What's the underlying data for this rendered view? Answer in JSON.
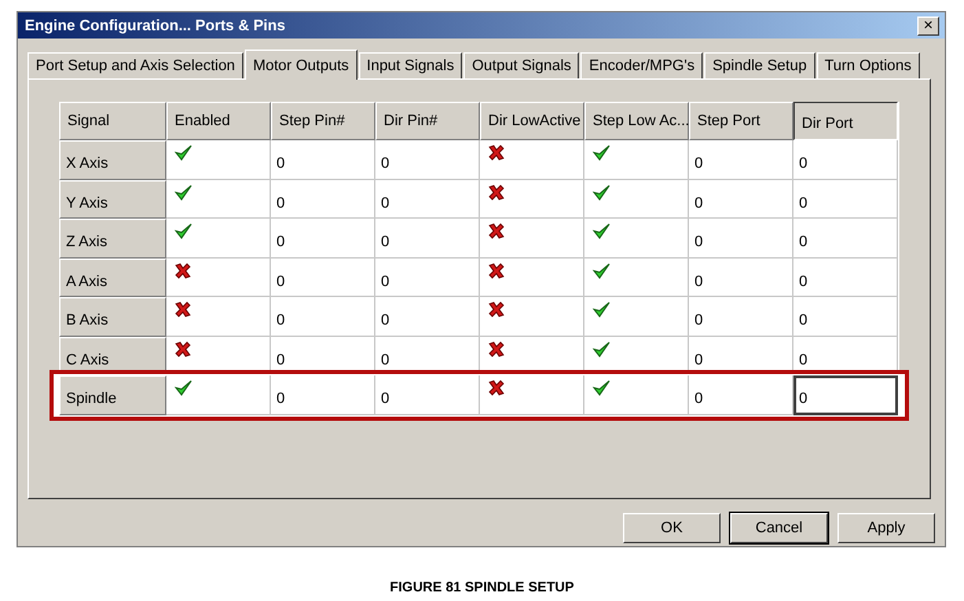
{
  "window": {
    "title": "Engine Configuration... Ports & Pins",
    "close": "×"
  },
  "tabs": [
    {
      "label": "Port Setup and Axis Selection",
      "selected": false
    },
    {
      "label": "Motor Outputs",
      "selected": true
    },
    {
      "label": "Input Signals",
      "selected": false
    },
    {
      "label": "Output Signals",
      "selected": false
    },
    {
      "label": "Encoder/MPG's",
      "selected": false
    },
    {
      "label": "Spindle Setup",
      "selected": false
    },
    {
      "label": "Turn Options",
      "selected": false
    }
  ],
  "table": {
    "columns": [
      {
        "label": "Signal",
        "kind": "text",
        "selected": false
      },
      {
        "label": "Enabled",
        "kind": "bool",
        "selected": false
      },
      {
        "label": "Step Pin#",
        "kind": "text",
        "selected": false
      },
      {
        "label": "Dir Pin#",
        "kind": "text",
        "selected": false
      },
      {
        "label": "Dir LowActive",
        "kind": "bool",
        "selected": false
      },
      {
        "label": "Step Low Ac...",
        "kind": "bool",
        "selected": false
      },
      {
        "label": "Step Port",
        "kind": "text",
        "selected": false
      },
      {
        "label": "Dir Port",
        "kind": "text",
        "selected": true
      }
    ],
    "rows": [
      {
        "cells": [
          "X Axis",
          true,
          "0",
          "0",
          false,
          true,
          "0",
          "0"
        ],
        "highlighted": false,
        "focused": false
      },
      {
        "cells": [
          "Y Axis",
          true,
          "0",
          "0",
          false,
          true,
          "0",
          "0"
        ],
        "highlighted": false,
        "focused": false
      },
      {
        "cells": [
          "Z Axis",
          true,
          "0",
          "0",
          false,
          true,
          "0",
          "0"
        ],
        "highlighted": false,
        "focused": false
      },
      {
        "cells": [
          "A Axis",
          false,
          "0",
          "0",
          false,
          true,
          "0",
          "0"
        ],
        "highlighted": false,
        "focused": false
      },
      {
        "cells": [
          "B Axis",
          false,
          "0",
          "0",
          false,
          true,
          "0",
          "0"
        ],
        "highlighted": false,
        "focused": false
      },
      {
        "cells": [
          "C Axis",
          false,
          "0",
          "0",
          false,
          true,
          "0",
          "0"
        ],
        "highlighted": false,
        "focused": false
      },
      {
        "cells": [
          "Spindle",
          true,
          "0",
          "0",
          false,
          true,
          "0",
          "0"
        ],
        "highlighted": true,
        "focused": true
      }
    ]
  },
  "buttons": [
    {
      "label": "OK",
      "default": false
    },
    {
      "label": "Cancel",
      "default": true
    },
    {
      "label": "Apply",
      "default": false
    }
  ],
  "caption": "FIGURE 81 SPINDLE SETUP"
}
